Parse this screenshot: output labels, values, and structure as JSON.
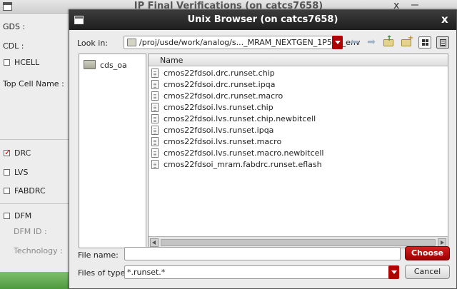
{
  "background_window": {
    "title": "IP Final Verifications (on catcs7658)",
    "close_glyph": "x",
    "labels": {
      "gds": "GDS :",
      "cdl": "CDL :",
      "hcell": "HCELL",
      "top_cell_name": "Top Cell Name :",
      "drc": "DRC",
      "lvs": "LVS",
      "fabdrc": "FABDRC",
      "dfm": "DFM",
      "dfm_id": "DFM ID :",
      "technology": "Technology :"
    },
    "checkboxes": {
      "hcell": false,
      "drc": true,
      "lvs": false,
      "fabdrc": false,
      "dfm": false
    }
  },
  "dialog": {
    "title": "Unix Browser (on catcs7658)",
    "close_glyph": "x",
    "look_in": {
      "label": "Look in:",
      "value": "/proj/usde/work/analog/s..._MRAM_NEXTGEN_1P5/ip_env"
    },
    "toolbar": {
      "back_icon": "back-arrow-icon",
      "forward_icon": "forward-arrow-icon",
      "parent_icon": "parent-folder-icon",
      "new_folder_icon": "new-folder-icon",
      "detail_view_icon": "grid-view-icon",
      "list_view_icon": "list-view-icon"
    },
    "sidebar": {
      "items": [
        {
          "label": "cds_oa",
          "icon": "folder-icon"
        }
      ]
    },
    "file_list": {
      "column_header": "Name",
      "files": [
        "cmos22fdsoi.drc.runset.chip",
        "cmos22fdsoi.drc.runset.ipqa",
        "cmos22fdsoi.drc.runset.macro",
        "cmos22fdsoi.lvs.runset.chip",
        "cmos22fdsoi.lvs.runset.chip.newbitcell",
        "cmos22fdsoi.lvs.runset.ipqa",
        "cmos22fdsoi.lvs.runset.macro",
        "cmos22fdsoi.lvs.runset.macro.newbitcell",
        "cmos22fdsoi_mram.fabdrc.runset.eflash"
      ]
    },
    "file_name": {
      "label": "File name:",
      "value": "",
      "placeholder": ""
    },
    "files_of_type": {
      "label": "Files of type:",
      "value": "*.runset.*"
    },
    "buttons": {
      "choose": "Choose",
      "cancel": "Cancel"
    },
    "colors": {
      "accent": "#b00000",
      "titlebar": "#2a2a2a"
    }
  }
}
